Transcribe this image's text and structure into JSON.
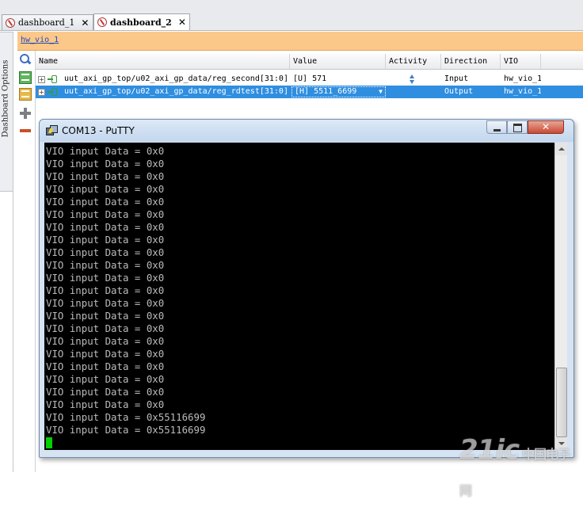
{
  "tabs": [
    {
      "label": "dashboard_1",
      "active": false
    },
    {
      "label": "dashboard_2",
      "active": true
    }
  ],
  "hw_header": {
    "link": "hw_vio_1"
  },
  "side_panel": {
    "label": "Dashboard Options"
  },
  "table": {
    "columns": [
      "Name",
      "Value",
      "Activity",
      "Direction",
      "VIO"
    ],
    "rows": [
      {
        "expand": "+",
        "name": "uut_axi_gp_top/u02_axi_gp_data/reg_second[31:0]",
        "value": "[U] 571",
        "activity": "up-down-arrow-icon",
        "direction": "Input",
        "vio": "hw_vio_1",
        "selected": false
      },
      {
        "expand": "+",
        "name": "uut_axi_gp_top/u02_axi_gp_data/reg_rdtest[31:0]",
        "value": "[H] 5511_6699",
        "activity": "",
        "direction": "Output",
        "vio": "hw_vio_1",
        "selected": true
      }
    ]
  },
  "putty": {
    "title": "COM13 - PuTTY",
    "lines": [
      "VIO input Data = 0x0",
      "VIO input Data = 0x0",
      "VIO input Data = 0x0",
      "VIO input Data = 0x0",
      "VIO input Data = 0x0",
      "VIO input Data = 0x0",
      "VIO input Data = 0x0",
      "VIO input Data = 0x0",
      "VIO input Data = 0x0",
      "VIO input Data = 0x0",
      "VIO input Data = 0x0",
      "VIO input Data = 0x0",
      "VIO input Data = 0x0",
      "VIO input Data = 0x0",
      "VIO input Data = 0x0",
      "VIO input Data = 0x0",
      "VIO input Data = 0x0",
      "VIO input Data = 0x0",
      "VIO input Data = 0x0",
      "VIO input Data = 0x0",
      "VIO input Data = 0x0",
      "VIO input Data = 0x55116699",
      "VIO input Data = 0x55116699"
    ],
    "text_color": "#bbbbbb",
    "cursor_color": "#00d000"
  },
  "watermark": {
    "text": "21ic",
    "sub": "中国电子网"
  },
  "colors": {
    "selection": "#2f8ee0",
    "header_orange": "#fbc88a",
    "link": "#2149b8"
  }
}
